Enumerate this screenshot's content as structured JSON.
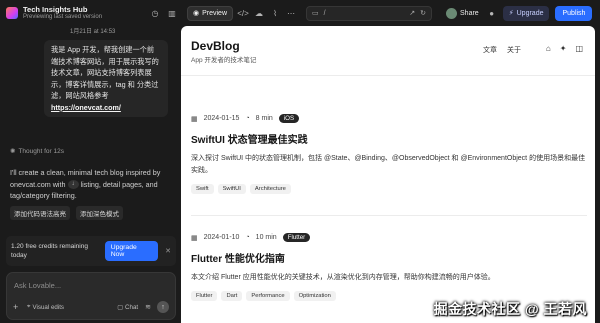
{
  "project": {
    "title": "Tech Insights Hub",
    "subtitle": "Previewing last saved version"
  },
  "toolbar": {
    "preview_label": "Preview",
    "address": "/",
    "share_label": "Share",
    "upgrade_label": "Upgrade",
    "publish_label": "Publish"
  },
  "chat": {
    "timestamp": "1月21日 at 14:53",
    "user_message_prefix": "我是 App 开发，帮我创建一个前端技术博客网站，用于展示我写的技术文章，网站支持博客列表展示，博客详情展示，tag 和 分类过滤，网站风格参考",
    "user_message_link": "https://onevcat.com/",
    "thought_label": "Thought for 12s",
    "ai_text_part1": "I'll create a clean, minimal tech blog inspired by onevcat.com with",
    "ai_text_part2": "listing, detail pages, and tag/category filtering.",
    "chips": [
      "添加代码语法高亮",
      "添加深色模式"
    ],
    "credits_text": "1.20 free credits remaining today",
    "upgrade_now_label": "Upgrade Now",
    "composer_placeholder": "Ask Lovable...",
    "visual_edits_label": "Visual edits",
    "chat_label": "Chat"
  },
  "site": {
    "title": "DevBlog",
    "subtitle": "App 开发者的技术笔记",
    "nav": [
      "文章",
      "关于"
    ],
    "posts": [
      {
        "date": "2024-01-15",
        "read_time": "8 min",
        "category": "iOS",
        "title": "SwiftUI 状态管理最佳实践",
        "excerpt": "深入探讨 SwiftUI 中的状态管理机制，包括 @State、@Binding、@ObservedObject 和 @EnvironmentObject 的使用场景和最佳实践。",
        "tags": [
          "Swift",
          "SwiftUI",
          "Architecture"
        ]
      },
      {
        "date": "2024-01-10",
        "read_time": "10 min",
        "category": "Flutter",
        "title": "Flutter 性能优化指南",
        "excerpt": "本文介绍 Flutter 应用性能优化的关键技术，从渲染优化到内存管理，帮助你构建流畅的用户体验。",
        "tags": [
          "Flutter",
          "Dart",
          "Performance",
          "Optimization"
        ]
      }
    ]
  },
  "watermark": "掘金技术社区 @ 王若风",
  "colors": {
    "accent": "#2a6dff",
    "background": "#1b1b1b",
    "tag_bg": "#262626"
  }
}
